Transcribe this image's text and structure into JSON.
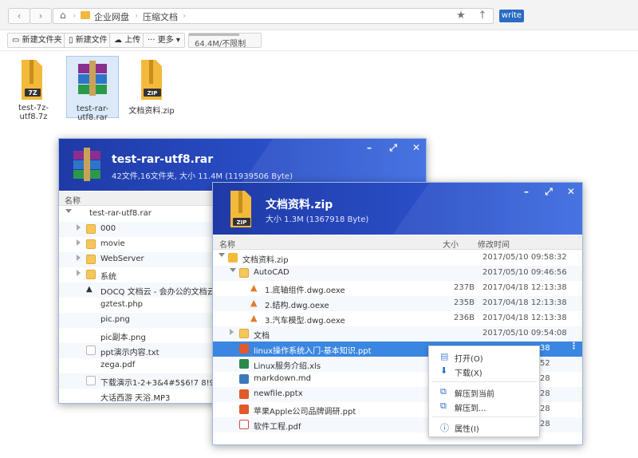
{
  "topbar": {
    "back_icon": "chevron-left-icon",
    "home_icon": "home-icon",
    "breadcrumb": [
      "企业网盘",
      "压缩文档"
    ],
    "write_label": "write"
  },
  "toolbar": {
    "new_folder": "新建文件夹",
    "new_file": "新建文件",
    "upload": "上传",
    "more": "更多",
    "quota": "64.4M/不限制",
    "quota_progress": 0.7
  },
  "desktop": [
    {
      "name": "test-7z-utf8.7z",
      "badge": "7Z"
    },
    {
      "name": "test-rar-utf8.rar",
      "badge": ""
    },
    {
      "name": "文档资料.zip",
      "badge": "ZIP"
    }
  ],
  "rar_window": {
    "title": "test-rar-utf8.rar",
    "subtitle": "42文件,16文件夹, 大小 11.4M (11939506 Byte)",
    "col_name": "名称",
    "rows": [
      {
        "name": "test-rar-utf8.rar",
        "type": "archive"
      },
      {
        "name": "000",
        "type": "folder"
      },
      {
        "name": "movie",
        "type": "folder"
      },
      {
        "name": "WebServer",
        "type": "folder"
      },
      {
        "name": "系统",
        "type": "folder"
      },
      {
        "name": "DOCQ 文档云 - 会办公的文档云.c",
        "type": "cad"
      },
      {
        "name": "gztest.php",
        "type": "php"
      },
      {
        "name": "pic.png",
        "type": "img"
      },
      {
        "name": "pic副本.png",
        "type": "img"
      },
      {
        "name": "ppt演示内容.txt",
        "type": "doc"
      },
      {
        "name": "zega.pdf",
        "type": "pdf"
      },
      {
        "name": "下载演示1-2+3&4#5$6!7 8!9.txt",
        "type": "doc"
      },
      {
        "name": "大话西游 天浴.MP3",
        "type": "audio"
      }
    ]
  },
  "zip_window": {
    "title": "文档资料.zip",
    "subtitle": "大小 1.3M (1367918 Byte)",
    "col_name": "名称",
    "col_size": "大小",
    "col_mtime": "修改时间",
    "rows": [
      {
        "name": "文档资料.zip",
        "size": "",
        "date": "2017/05/10 09:58:32"
      },
      {
        "name": "AutoCAD",
        "size": "",
        "date": "2017/05/10 09:46:56"
      },
      {
        "name": "1.底轴组件.dwg.oexe",
        "size": "237B",
        "date": "2017/04/18 12:13:38"
      },
      {
        "name": "2.结构.dwg.oexe",
        "size": "235B",
        "date": "2017/04/18 12:13:38"
      },
      {
        "name": "3.汽车模型.dwg.oexe",
        "size": "236B",
        "date": "2017/04/18 12:13:38"
      },
      {
        "name": "文档",
        "size": "",
        "date": "2017/05/10 09:54:08"
      },
      {
        "name": "linux操作系统入门-基本知识.ppt",
        "size": "",
        "date": "38"
      },
      {
        "name": "Linux服务介绍.xls",
        "size": "",
        "date": "52"
      },
      {
        "name": "markdown.md",
        "size": "",
        "date": "28"
      },
      {
        "name": "newfile.pptx",
        "size": "",
        "date": "28"
      },
      {
        "name": "苹果Apple公司品牌调研.ppt",
        "size": "",
        "date": "28"
      },
      {
        "name": "软件工程.pdf",
        "size": "",
        "date": "28"
      }
    ]
  },
  "context_menu": {
    "open": "打开(O)",
    "download": "下载(X)",
    "extract_here": "解压到当前",
    "extract_to": "解压到...",
    "properties": "属性(I)"
  },
  "colors": {
    "accent": "#2b6bc4",
    "header_blue": "#2a4fc8",
    "highlight": "#3a86e0"
  }
}
